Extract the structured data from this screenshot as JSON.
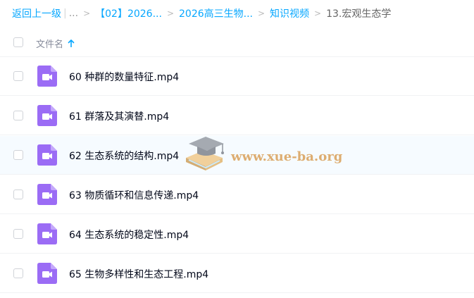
{
  "breadcrumb": {
    "back": "返回上一级",
    "ellipsis": "...",
    "crumb1": "【02】2026...",
    "crumb2": "2026高三生物...",
    "crumb3": "知识视频",
    "current": "13.宏观生态学",
    "separator": ">",
    "divider": "|"
  },
  "header": {
    "column_title": "文件名",
    "sort_icon": "arrow-up-icon"
  },
  "files": [
    {
      "name": "60 种群的数量特征.mp4",
      "icon": "video-file-icon"
    },
    {
      "name": "61 群落及其演替.mp4",
      "icon": "video-file-icon"
    },
    {
      "name": "62 生态系统的结构.mp4",
      "icon": "video-file-icon"
    },
    {
      "name": "63 物质循环和信息传递.mp4",
      "icon": "video-file-icon"
    },
    {
      "name": "64 生态系统的稳定性.mp4",
      "icon": "video-file-icon"
    },
    {
      "name": "65 生物多样性和生态工程.mp4",
      "icon": "video-file-icon"
    }
  ],
  "watermark": {
    "text": "www.xue-ba.org"
  },
  "colors": {
    "link": "#06a7ff",
    "video_icon": "#9b6cf5",
    "row_hover": "#f6fbff",
    "watermark": "#d89a4e"
  }
}
